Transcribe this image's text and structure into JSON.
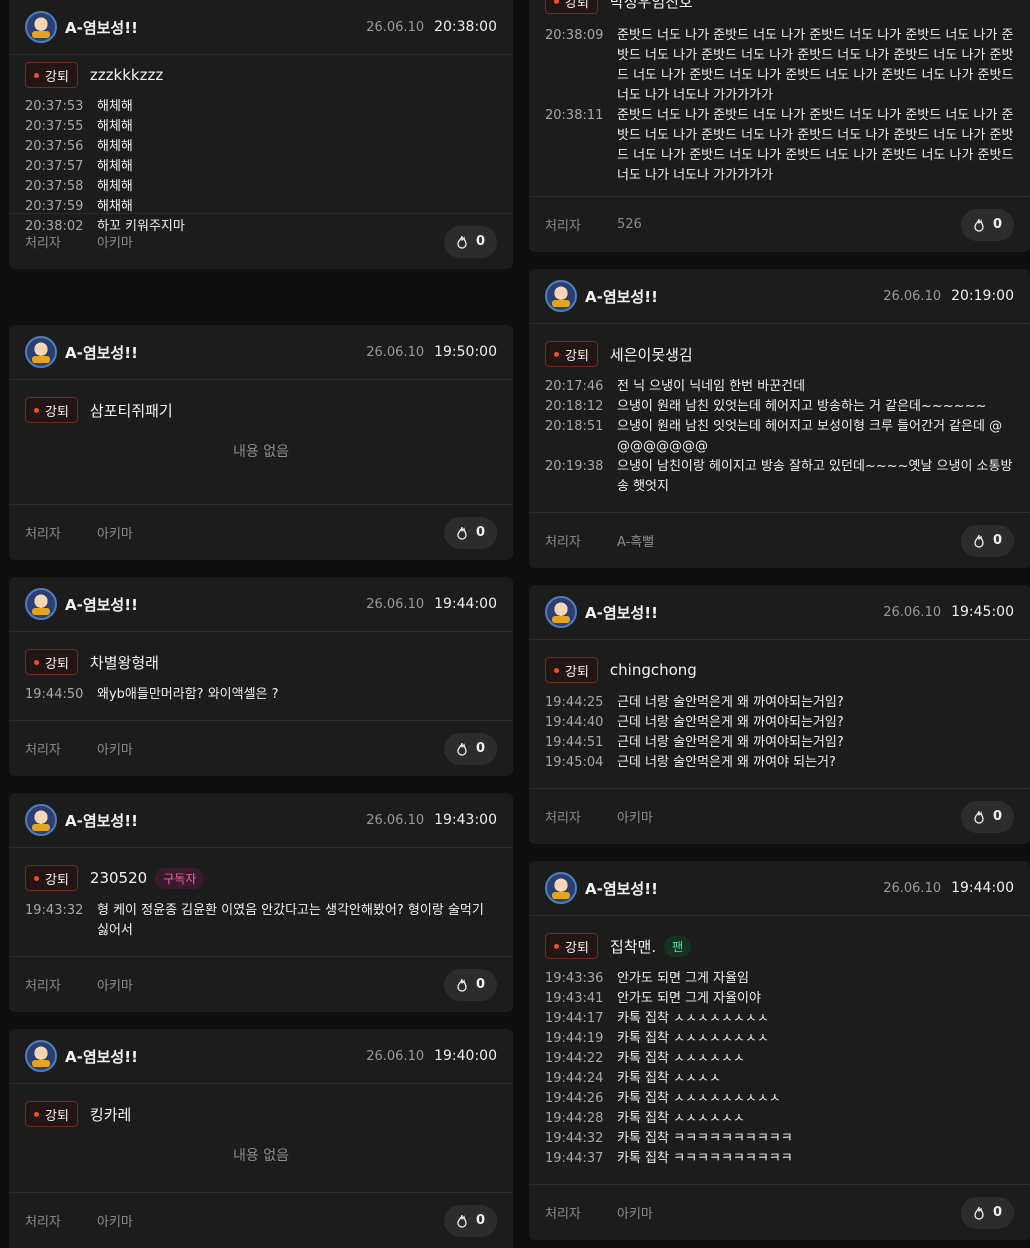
{
  "labels": {
    "tag": "강퇴",
    "handler": "처리자",
    "empty": "내용 없음"
  },
  "left": [
    {
      "author": "A-염보성!!",
      "date": "26.06.10",
      "time": "20:38:00",
      "target": "zzzkkkzzz",
      "messages": [
        {
          "t": "20:37:53",
          "m": "해체해"
        },
        {
          "t": "20:37:55",
          "m": "해체해"
        },
        {
          "t": "20:37:56",
          "m": "해체해"
        },
        {
          "t": "20:37:57",
          "m": "해체해"
        },
        {
          "t": "20:37:58",
          "m": "해체해"
        },
        {
          "t": "20:37:59",
          "m": "해채해"
        },
        {
          "t": "20:38:02",
          "m": "하꼬 키워주지마"
        }
      ],
      "handler": "아키마",
      "likes": "0"
    },
    {
      "author": "A-염보성!!",
      "date": "26.06.10",
      "time": "19:50:00",
      "target": "삼포티쥐패기",
      "messages": [],
      "handler": "아키마",
      "likes": "0"
    },
    {
      "author": "A-염보성!!",
      "date": "26.06.10",
      "time": "19:44:00",
      "target": "차별왕형래",
      "messages": [
        {
          "t": "19:44:50",
          "m": "왜yb애들만머라함? 와이액셀은 ?"
        }
      ],
      "handler": "아키마",
      "likes": "0"
    },
    {
      "author": "A-염보성!!",
      "date": "26.06.10",
      "time": "19:43:00",
      "target": "230520",
      "badge": "구독자",
      "messages": [
        {
          "t": "19:43:32",
          "m": "형 케이 정윤종 김윤환 이였음 안갔다고는 생각안해봤어? 형이랑 술먹기 싫어서"
        }
      ],
      "handler": "아키마",
      "likes": "0"
    },
    {
      "author": "A-염보성!!",
      "date": "26.06.10",
      "time": "19:40:00",
      "target": "킹카레",
      "messages": [],
      "handler": "아키마",
      "likes": "0"
    }
  ],
  "right": [
    {
      "target": "박정우임진호",
      "messages": [
        {
          "t": "20:38:09",
          "m": "준밧드 너도 나가 준밧드 너도 나가 준밧드 너도 나가 준밧드 너도 나가 준밧드 너도 나가 준밧드 너도 나가 준밧드 너도 나가 준밧드 너도 나가 준밧드 너도 나가 준밧드 너도 나가 준밧드 너도 나가 준밧드 너도 나가 준밧드 너도 나가 너도나 가가가가가"
        },
        {
          "t": "20:38:11",
          "m": "준밧드 너도 나가 준밧드 너도 나가 준밧드 너도 나가 준밧드 너도 나가 준밧드 너도 나가 준밧드 너도 나가 준밧드 너도 나가 준밧드 너도 나가 준밧드 너도 나가 준밧드 너도 나가 준밧드 너도 나가 준밧드 너도 나가 준밧드 너도 나가 너도나 가가가가가"
        }
      ],
      "handler": "526",
      "likes": "0"
    },
    {
      "author": "A-염보성!!",
      "date": "26.06.10",
      "time": "20:19:00",
      "target": "세은이못생김",
      "messages": [
        {
          "t": "20:17:46",
          "m": "전 닉 으냉이 닉네임 한번 바꾼건데"
        },
        {
          "t": "20:18:12",
          "m": "으냉이 원래 남친 있엇는데 헤어지고 방송하는 거 같은데~~~~~~"
        },
        {
          "t": "20:18:51",
          "m": "으냉이 원래 남친 잇엇는데 헤어지고 보성이형 크루 들어간거 같은데 @@@@@@@@"
        },
        {
          "t": "20:19:38",
          "m": "으냉이 남친이랑 헤이지고 방송 잘하고 있던데~~~~옛날 으냉이 소통방송 햇엇지"
        }
      ],
      "handler": "A-흑뻘",
      "likes": "0"
    },
    {
      "author": "A-염보성!!",
      "date": "26.06.10",
      "time": "19:45:00",
      "target": "chingchong",
      "messages": [
        {
          "t": "19:44:25",
          "m": "근데 너랑 술안먹은게 왜 까여야되는거임?"
        },
        {
          "t": "19:44:40",
          "m": "근데 너랑 술안먹은게 왜 까여야되는거임?"
        },
        {
          "t": "19:44:51",
          "m": "근데 너랑 술안먹은게 왜 까여야되는거임?"
        },
        {
          "t": "19:45:04",
          "m": "근데 너랑 술안먹은게 왜 까여야 되는거?"
        }
      ],
      "handler": "아키마",
      "likes": "0"
    },
    {
      "author": "A-염보성!!",
      "date": "26.06.10",
      "time": "19:44:00",
      "target": "집착맨.",
      "badge": "팬",
      "messages": [
        {
          "t": "19:43:36",
          "m": "안가도 되면 그게 자율임"
        },
        {
          "t": "19:43:41",
          "m": "안가도 되면 그게 자율이야"
        },
        {
          "t": "19:44:17",
          "m": "카톡 집착 ㅅㅅㅅㅅㅅㅅㅅㅅ"
        },
        {
          "t": "19:44:19",
          "m": "카톡 집착 ㅅㅅㅅㅅㅅㅅㅅㅅ"
        },
        {
          "t": "19:44:22",
          "m": "카톡 집착 ㅅㅅㅅㅅㅅㅅ"
        },
        {
          "t": "19:44:24",
          "m": "카톡 집착 ㅅㅅㅅㅅ"
        },
        {
          "t": "19:44:26",
          "m": "카톡 집착 ㅅㅅㅅㅅㅅㅅㅅㅅㅅ"
        },
        {
          "t": "19:44:28",
          "m": "카톡 집착 ㅅㅅㅅㅅㅅㅅ"
        },
        {
          "t": "19:44:32",
          "m": "카톡 집착 ㅋㅋㅋㅋㅋㅋㅋㅋㅋㅋ"
        },
        {
          "t": "19:44:37",
          "m": "카톡 집착 ㅋㅋㅋㅋㅋㅋㅋㅋㅋㅋ"
        }
      ],
      "handler": "아키마",
      "likes": "0"
    }
  ]
}
